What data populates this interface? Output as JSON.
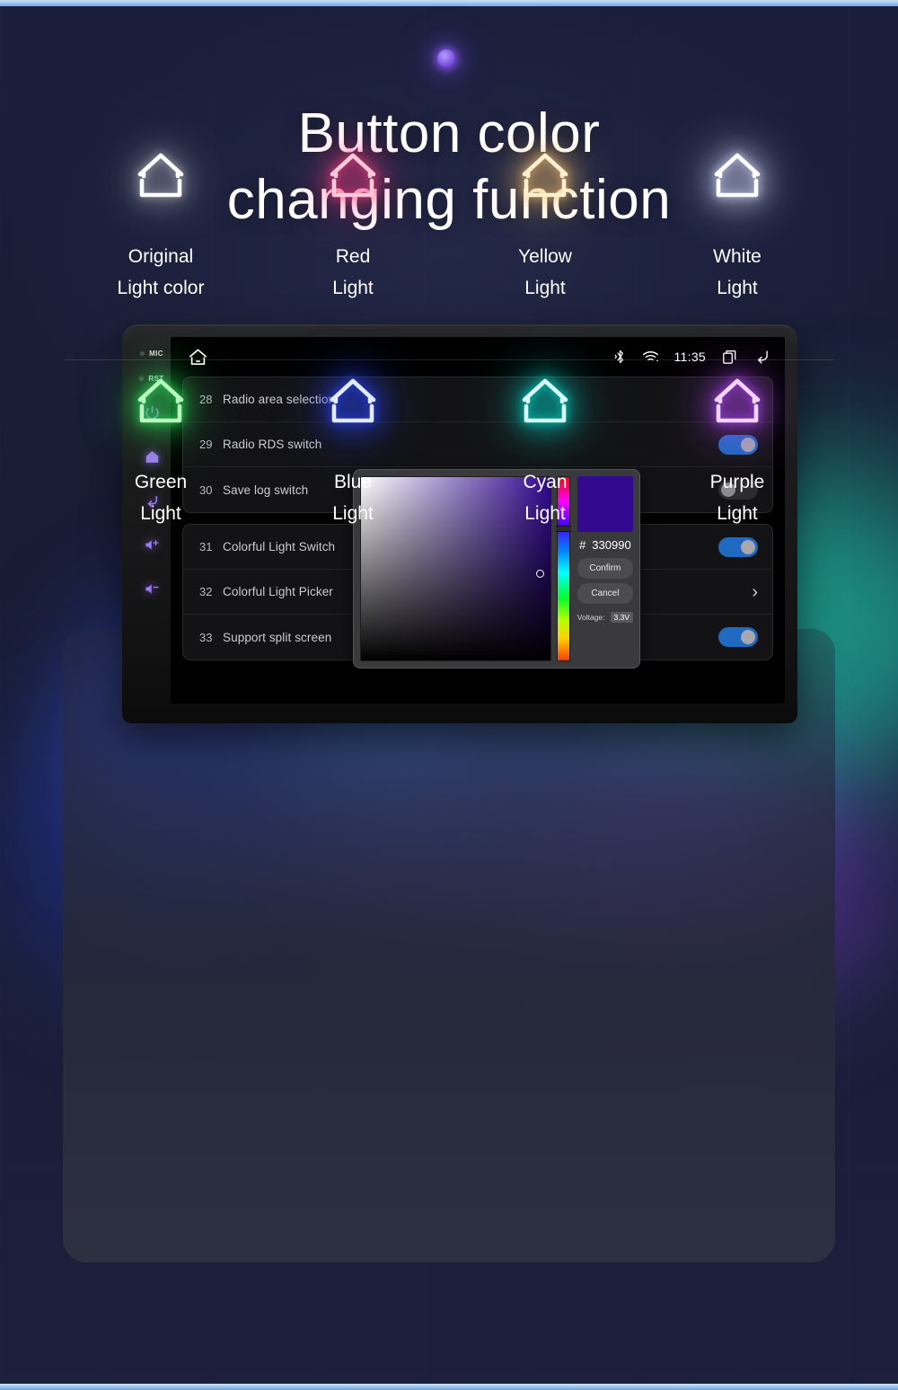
{
  "headline": {
    "line1": "Button color",
    "line2": "changing function"
  },
  "indicator": {
    "name": "glow-dot"
  },
  "head_unit": {
    "hardware_buttons": [
      {
        "name": "mic-indicator",
        "label": "MIC",
        "type": "dot-label"
      },
      {
        "name": "reset-indicator",
        "label": "RST",
        "type": "dot-label"
      },
      {
        "name": "power-button",
        "icon": "power-icon"
      },
      {
        "name": "home-button",
        "icon": "house-icon"
      },
      {
        "name": "back-button",
        "icon": "back-arrow-icon"
      },
      {
        "name": "volume-up-button",
        "icon": "volume-up-icon"
      },
      {
        "name": "volume-down-button",
        "icon": "volume-down-icon"
      }
    ],
    "status_bar": {
      "home_icon": "house-icon",
      "bluetooth_icon": "bluetooth-icon",
      "wifi_icon": "wifi-icon",
      "clock": "11:35",
      "recents_icon": "recent-apps-icon",
      "back_icon": "back-arrow-icon"
    },
    "settings_groups": [
      {
        "rows": [
          {
            "num": "28",
            "label": "Radio area selection",
            "control": "chevron",
            "chevron": "›"
          },
          {
            "num": "29",
            "label": "Radio RDS switch",
            "control": "toggle",
            "state": "on"
          },
          {
            "num": "30",
            "label": "Save log switch",
            "control": "toggle",
            "state": "off"
          }
        ]
      },
      {
        "rows": [
          {
            "num": "31",
            "label": "Colorful Light Switch",
            "control": "toggle",
            "state": "on"
          },
          {
            "num": "32",
            "label": "Colorful Light Picker",
            "control": "chevron",
            "chevron": "›"
          },
          {
            "num": "33",
            "label": "Support split screen",
            "control": "toggle",
            "state": "on"
          }
        ]
      }
    ],
    "color_dialog": {
      "hex_symbol": "#",
      "hex_value": "330990",
      "preview_color": "#330990",
      "confirm_label": "Confirm",
      "cancel_label": "Cancel",
      "voltage_label": "Voltage:",
      "voltage_value": "3.3V"
    }
  },
  "light_colors": {
    "row1": [
      {
        "name": "original-light",
        "line1": "Original",
        "line2": "Light color",
        "color": "#ffffff",
        "glow": "rgba(255,255,255,0.55)"
      },
      {
        "name": "red-light",
        "line1": "Red",
        "line2": "Light",
        "color": "#ffc9d8",
        "glow": "rgba(255,60,130,0.85)"
      },
      {
        "name": "yellow-light",
        "line1": "Yellow",
        "line2": "Light",
        "color": "#fff0d2",
        "glow": "rgba(255,200,110,0.85)"
      },
      {
        "name": "white-light",
        "line1": "White",
        "line2": "Light",
        "color": "#ffffff",
        "glow": "rgba(220,225,255,0.9)"
      }
    ],
    "row2": [
      {
        "name": "green-light",
        "line1": "Green",
        "line2": "Light",
        "color": "#b9f7c0",
        "glow": "rgba(40,235,90,0.9)"
      },
      {
        "name": "blue-light",
        "line1": "Blue",
        "line2": "Light",
        "color": "#e3ecff",
        "glow": "rgba(40,70,255,0.95)"
      },
      {
        "name": "cyan-light",
        "line1": "Cyan",
        "line2": "Light",
        "color": "#d7fbf6",
        "glow": "rgba(0,230,215,0.9)"
      },
      {
        "name": "purple-light",
        "line1": "Purple",
        "line2": "Light",
        "color": "#f0d5ff",
        "glow": "rgba(185,70,255,0.92)"
      }
    ]
  }
}
